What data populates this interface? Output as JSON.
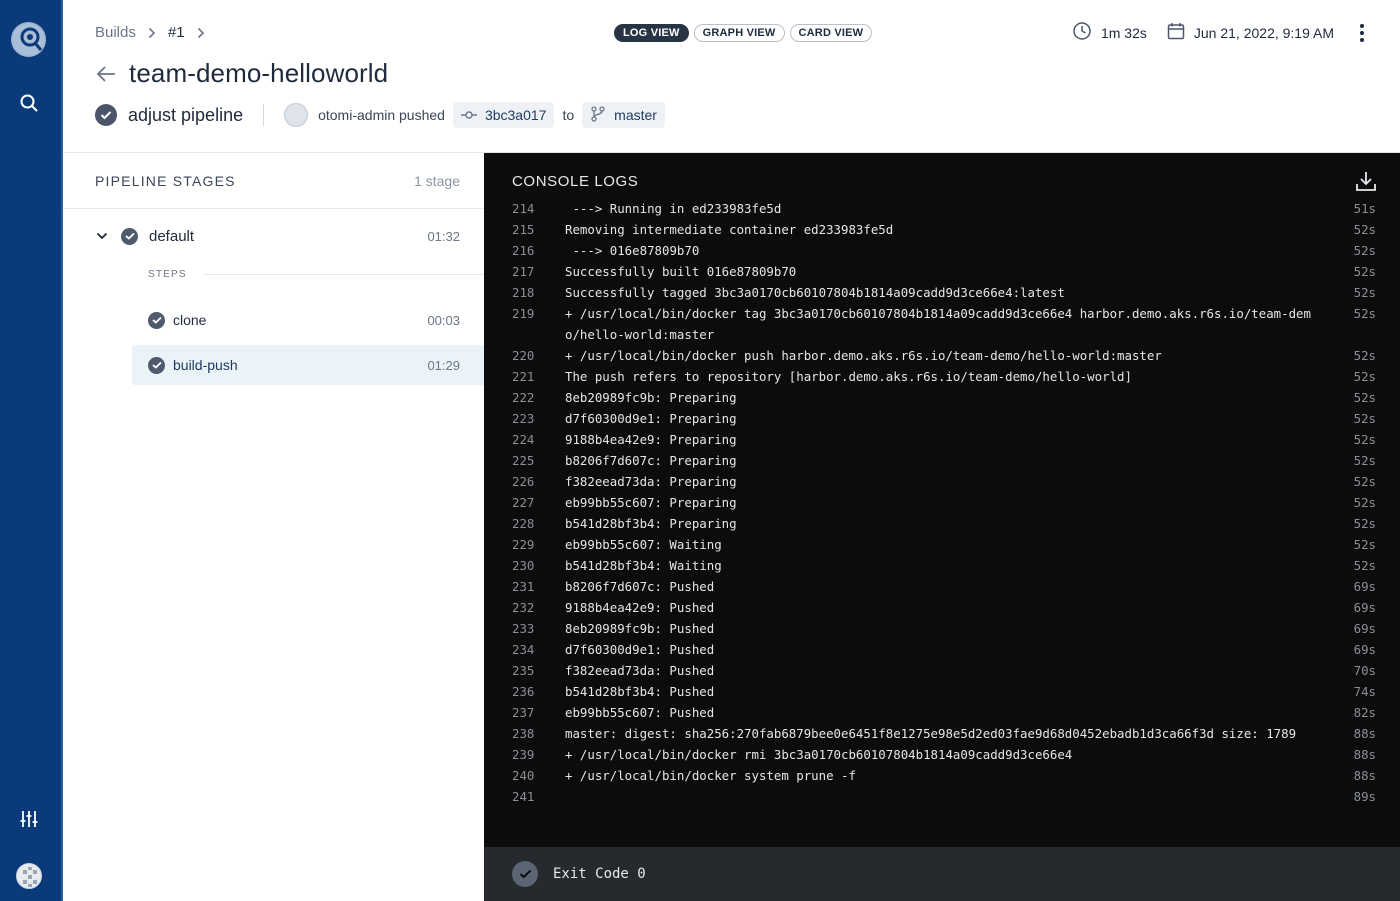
{
  "breadcrumb": {
    "builds": "Builds",
    "build_number": "#1"
  },
  "view_tabs": [
    {
      "label": "LOG VIEW",
      "active": true
    },
    {
      "label": "GRAPH VIEW",
      "active": false
    },
    {
      "label": "CARD VIEW",
      "active": false
    }
  ],
  "meta": {
    "duration": "1m 32s",
    "date": "Jun 21, 2022, 9:19 AM"
  },
  "page_title": "team-demo-helloworld",
  "commit": {
    "message": "adjust pipeline",
    "author_action": "otomi-admin pushed",
    "sha": "3bc3a017",
    "to_word": "to",
    "branch": "master"
  },
  "pipeline": {
    "title": "PIPELINE STAGES",
    "count": "1 stage",
    "stage": {
      "name": "default",
      "time": "01:32"
    },
    "steps_label": "STEPS",
    "steps": [
      {
        "name": "clone",
        "time": "00:03",
        "active": false
      },
      {
        "name": "build-push",
        "time": "01:29",
        "active": true
      }
    ]
  },
  "console": {
    "title": "CONSOLE LOGS",
    "lines": [
      {
        "n": "214",
        "t": " ---> Running in ed233983fe5d",
        "d": "51s"
      },
      {
        "n": "215",
        "t": "Removing intermediate container ed233983fe5d",
        "d": "52s"
      },
      {
        "n": "216",
        "t": " ---> 016e87809b70",
        "d": "52s"
      },
      {
        "n": "217",
        "t": "Successfully built 016e87809b70",
        "d": "52s"
      },
      {
        "n": "218",
        "t": "Successfully tagged 3bc3a0170cb60107804b1814a09cadd9d3ce66e4:latest",
        "d": "52s"
      },
      {
        "n": "219",
        "t": "+ /usr/local/bin/docker tag 3bc3a0170cb60107804b1814a09cadd9d3ce66e4 harbor.demo.aks.r6s.io/team-demo/hello-world:master",
        "d": "52s"
      },
      {
        "n": "220",
        "t": "+ /usr/local/bin/docker push harbor.demo.aks.r6s.io/team-demo/hello-world:master",
        "d": "52s"
      },
      {
        "n": "221",
        "t": "The push refers to repository [harbor.demo.aks.r6s.io/team-demo/hello-world]",
        "d": "52s"
      },
      {
        "n": "222",
        "t": "8eb20989fc9b: Preparing",
        "d": "52s"
      },
      {
        "n": "223",
        "t": "d7f60300d9e1: Preparing",
        "d": "52s"
      },
      {
        "n": "224",
        "t": "9188b4ea42e9: Preparing",
        "d": "52s"
      },
      {
        "n": "225",
        "t": "b8206f7d607c: Preparing",
        "d": "52s"
      },
      {
        "n": "226",
        "t": "f382eead73da: Preparing",
        "d": "52s"
      },
      {
        "n": "227",
        "t": "eb99bb55c607: Preparing",
        "d": "52s"
      },
      {
        "n": "228",
        "t": "b541d28bf3b4: Preparing",
        "d": "52s"
      },
      {
        "n": "229",
        "t": "eb99bb55c607: Waiting",
        "d": "52s"
      },
      {
        "n": "230",
        "t": "b541d28bf3b4: Waiting",
        "d": "52s"
      },
      {
        "n": "231",
        "t": "b8206f7d607c: Pushed",
        "d": "69s"
      },
      {
        "n": "232",
        "t": "9188b4ea42e9: Pushed",
        "d": "69s"
      },
      {
        "n": "233",
        "t": "8eb20989fc9b: Pushed",
        "d": "69s"
      },
      {
        "n": "234",
        "t": "d7f60300d9e1: Pushed",
        "d": "69s"
      },
      {
        "n": "235",
        "t": "f382eead73da: Pushed",
        "d": "70s"
      },
      {
        "n": "236",
        "t": "b541d28bf3b4: Pushed",
        "d": "74s"
      },
      {
        "n": "237",
        "t": "eb99bb55c607: Pushed",
        "d": "82s"
      },
      {
        "n": "238",
        "t": "master: digest: sha256:270fab6879bee0e6451f8e1275e98e5d2ed03fae9d68d0452ebadb1d3ca66f3d size: 1789",
        "d": "88s"
      },
      {
        "n": "239",
        "t": "+ /usr/local/bin/docker rmi 3bc3a0170cb60107804b1814a09cadd9d3ce66e4",
        "d": "88s"
      },
      {
        "n": "240",
        "t": "+ /usr/local/bin/docker system prune -f",
        "d": "88s"
      },
      {
        "n": "241",
        "t": "",
        "d": "89s"
      }
    ],
    "exit_text": "Exit Code 0"
  },
  "colors": {
    "sidebar": "#0b3a7a",
    "console_bg": "#0c0c0c",
    "active_step": "#eaf3f7"
  },
  "icons": [
    "logo-icon",
    "search-icon",
    "sliders-icon",
    "user-avatar",
    "clock-icon",
    "calendar-icon",
    "kebab-icon",
    "back-arrow-icon",
    "commit-icon",
    "branch-icon",
    "check-icon",
    "chevron-down-icon",
    "download-icon"
  ]
}
